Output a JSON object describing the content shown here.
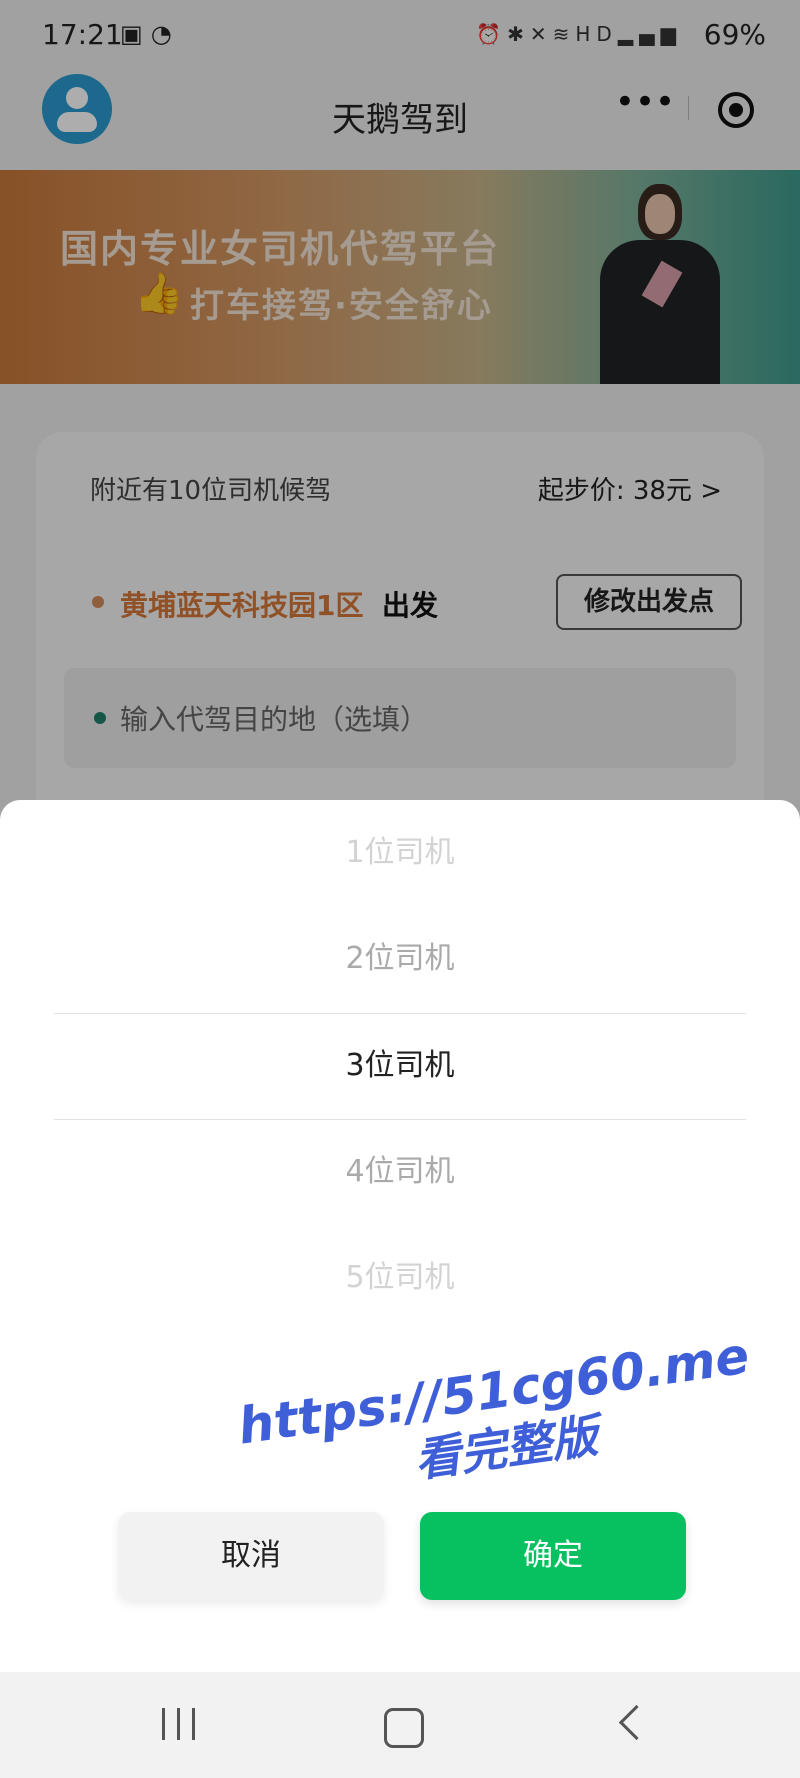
{
  "status_bar": {
    "time": "17:21",
    "left_icons": [
      "image-icon",
      "sync-icon"
    ],
    "right_icons": [
      "alarm-icon",
      "bluetooth-icon",
      "mute-icon",
      "wifi-icon",
      "hd-icon",
      "5g-signal-icon"
    ],
    "battery": "69%"
  },
  "navbar": {
    "title": "天鹅驾到",
    "more": "•••"
  },
  "banner": {
    "line1": "国内专业女司机代驾平台",
    "line2": "打车接驾·安全舒心"
  },
  "card": {
    "nearby": "附近有10位司机候驾",
    "price": "起步价: 38元 >",
    "origin": "黄埔蓝天科技园1区",
    "depart": "出发",
    "modify_button": "修改出发点",
    "destination_placeholder": "输入代驾目的地（选填）"
  },
  "picker": {
    "items": [
      "1位司机",
      "2位司机",
      "3位司机",
      "4位司机",
      "5位司机"
    ],
    "selected_index": 2,
    "cancel": "取消",
    "confirm": "确定"
  },
  "watermark": {
    "url": "https://51cg60.me",
    "text": "看完整版"
  },
  "colors": {
    "accent": "#07c160",
    "origin": "#d4783a",
    "watermark": "#3f5fd8"
  }
}
